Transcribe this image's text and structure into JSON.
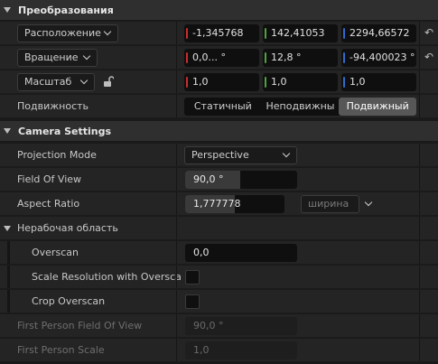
{
  "transform": {
    "title": "Преобразования",
    "location": {
      "label": "Расположение",
      "x": "-1,345768",
      "y": "142,41053",
      "z": "2294,66572"
    },
    "rotation": {
      "label": "Вращение",
      "x": "0,0... °",
      "y": "12,8 °",
      "z": "-94,400023 °"
    },
    "scale": {
      "label": "Масштаб",
      "x": "1,0",
      "y": "1,0",
      "z": "1,0"
    },
    "mobility": {
      "label": "Подвижность",
      "options": [
        "Статичный",
        "Неподвижны",
        "Подвижный"
      ],
      "selected": "Подвижный"
    }
  },
  "camera": {
    "title": "Camera Settings",
    "projection_mode": {
      "label": "Projection Mode",
      "value": "Perspective"
    },
    "field_of_view": {
      "label": "Field Of View",
      "value": "90,0 °",
      "slider_fraction": 0.49
    },
    "aspect_ratio": {
      "label": "Aspect Ratio",
      "value": "1,777778",
      "slider_fraction": 0.5,
      "preset": "ширина"
    },
    "overscan_group": {
      "label": "Нерабочая область",
      "overscan": {
        "label": "Overscan",
        "value": "0,0"
      },
      "scale_resolution": {
        "label": "Scale Resolution with Oversca",
        "checked": false
      },
      "crop_overscan": {
        "label": "Crop Overscan",
        "checked": false
      }
    },
    "first_person_fov": {
      "label": "First Person Field Of View",
      "value": "90,0 °"
    },
    "first_person_scale": {
      "label": "First Person Scale",
      "value": "1,0"
    }
  }
}
